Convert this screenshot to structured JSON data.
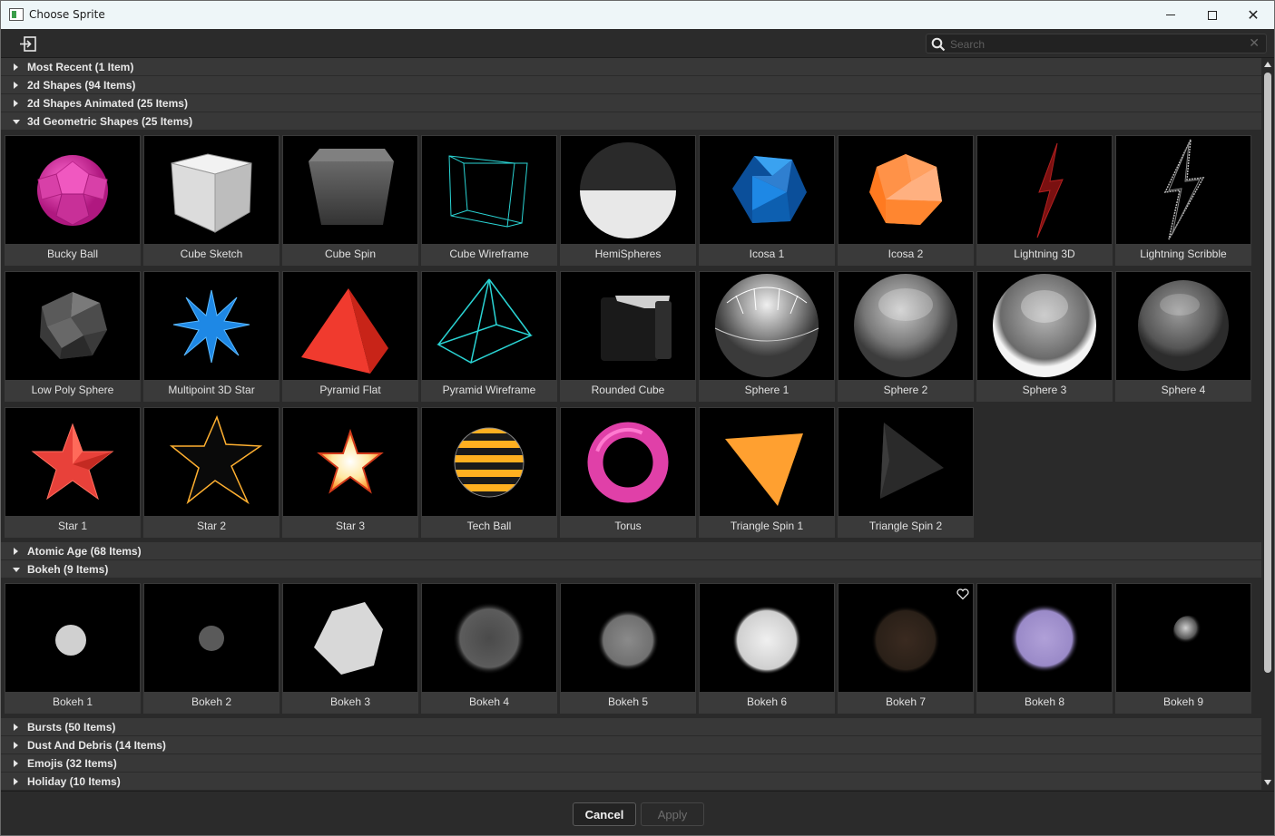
{
  "window": {
    "title": "Choose Sprite",
    "minimize": "—",
    "close": "✕"
  },
  "search": {
    "placeholder": "Search",
    "value": "",
    "clear": "✕"
  },
  "categories": [
    {
      "label": "Most Recent (1 Item)",
      "expanded": false
    },
    {
      "label": "2d Shapes (94 Items)",
      "expanded": false
    },
    {
      "label": "2d Shapes Animated (25 Items)",
      "expanded": false
    },
    {
      "label": "3d Geometric Shapes (25 Items)",
      "expanded": true,
      "items": [
        "Bucky Ball",
        "Cube Sketch",
        "Cube Spin",
        "Cube Wireframe",
        "HemiSpheres",
        "Icosa 1",
        "Icosa 2",
        "Lightning 3D",
        "Lightning Scribble",
        "Low Poly Sphere",
        "Multipoint 3D Star",
        "Pyramid Flat",
        "Pyramid Wireframe",
        "Rounded Cube",
        "Sphere 1",
        "Sphere 2",
        "Sphere 3",
        "Sphere 4",
        "Star 1",
        "Star 2",
        "Star 3",
        "Tech Ball",
        "Torus",
        "Triangle Spin 1",
        "Triangle Spin 2"
      ]
    },
    {
      "label": "Atomic Age (68 Items)",
      "expanded": false
    },
    {
      "label": "Bokeh (9 Items)",
      "expanded": true,
      "items": [
        "Bokeh 1",
        "Bokeh 2",
        "Bokeh 3",
        "Bokeh 4",
        "Bokeh 5",
        "Bokeh 6",
        "Bokeh 7",
        "Bokeh 8",
        "Bokeh 9"
      ]
    },
    {
      "label": "Bursts (50 Items)",
      "expanded": false
    },
    {
      "label": "Dust And Debris (14 Items)",
      "expanded": false
    },
    {
      "label": "Emojis (32 Items)",
      "expanded": false
    },
    {
      "label": "Holiday (10 Items)",
      "expanded": false
    }
  ],
  "footer": {
    "cancel_label": "Cancel",
    "apply_label": "Apply"
  },
  "colors": {
    "accent_pink": "#e040a8",
    "accent_orange": "#ff8a30",
    "accent_blue": "#1e88e5",
    "accent_cyan": "#2ad4d4",
    "accent_red": "#f03a2e"
  }
}
